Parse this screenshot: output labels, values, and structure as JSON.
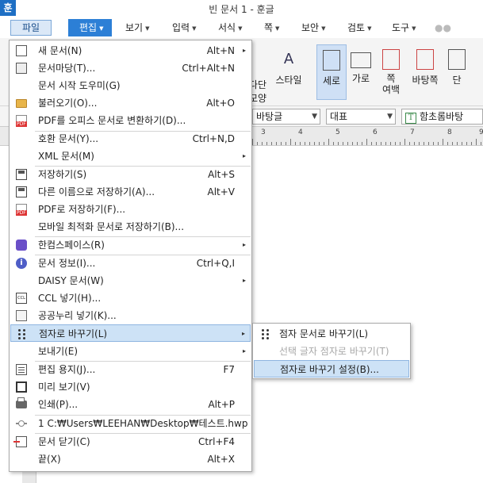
{
  "app": {
    "logo": "훈",
    "title": "빈 문서 1 - 훈글"
  },
  "menubar": {
    "file": "파일",
    "edit": "편집",
    "view": "보기",
    "input": "입력",
    "format": "서식",
    "page": "쪽",
    "security": "보안",
    "review": "검토",
    "tools": "도구"
  },
  "ribbon": {
    "column": "다단",
    "column2": "모양",
    "style": "스타일",
    "portrait": "세로",
    "landscape": "가로",
    "margin": "쪽",
    "margin2": "여백",
    "pagebg": "바탕쪽",
    "more": "단"
  },
  "fmtbar": {
    "style": "바탕글",
    "lang": "대표",
    "font_icon": "T",
    "font": "함초롬바탕"
  },
  "ruler": {
    "marks": [
      "3",
      "4",
      "5",
      "6",
      "7",
      "8",
      "9"
    ]
  },
  "file_menu": {
    "items": [
      {
        "label": "새 문서(N)",
        "shortcut": "Alt+N",
        "arrow": "▸"
      },
      {
        "label": "문서마당(T)...",
        "shortcut": "Ctrl+Alt+N"
      },
      {
        "label": "문서 시작 도우미(G)"
      },
      {
        "label": "불러오기(O)...",
        "shortcut": "Alt+O"
      },
      {
        "label": "PDF를 오피스 문서로 변환하기(D)..."
      },
      {
        "label": "호환 문서(Y)...",
        "shortcut": "Ctrl+N,D"
      },
      {
        "label": "XML 문서(M)",
        "arrow": "▸"
      },
      {
        "label": "저장하기(S)",
        "shortcut": "Alt+S"
      },
      {
        "label": "다른 이름으로 저장하기(A)...",
        "shortcut": "Alt+V"
      },
      {
        "label": "PDF로 저장하기(F)..."
      },
      {
        "label": "모바일 최적화 문서로 저장하기(B)..."
      },
      {
        "label": "한컴스페이스(R)",
        "arrow": "▸"
      },
      {
        "label": "문서 정보(I)...",
        "shortcut": "Ctrl+Q,I"
      },
      {
        "label": "DAISY 문서(W)",
        "arrow": "▸"
      },
      {
        "label": "CCL 넣기(H)..."
      },
      {
        "label": "공공누리 넣기(K)..."
      },
      {
        "label": "점자로 바꾸기(L)",
        "arrow": "▸"
      },
      {
        "label": "보내기(E)",
        "arrow": "▸"
      },
      {
        "label": "편집 용지(J)...",
        "shortcut": "F7"
      },
      {
        "label": "미리 보기(V)"
      },
      {
        "label": "인쇄(P)...",
        "shortcut": "Alt+P"
      },
      {
        "label": "1 C:₩Users₩LEEHAN₩Desktop₩테스트.hwp"
      },
      {
        "label": "문서 닫기(C)",
        "shortcut": "Ctrl+F4"
      },
      {
        "label": "끝(X)",
        "shortcut": "Alt+X"
      }
    ]
  },
  "braille_submenu": {
    "items": [
      {
        "label": "점자 문서로 바꾸기(L)"
      },
      {
        "label": "선택 글자 점자로 바꾸기(T)"
      },
      {
        "label": "점자로 바꾸기 설정(B)..."
      }
    ]
  }
}
